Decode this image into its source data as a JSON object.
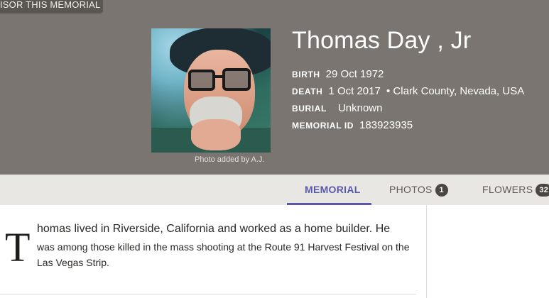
{
  "sponsor": {
    "label": "ISOR THIS MEMORIAL"
  },
  "photo": {
    "credit": "Photo added by A.J."
  },
  "person": {
    "name": "Thomas Day , Jr",
    "birth_label": "BIRTH",
    "birth_value": "29 Oct 1972",
    "death_label": "DEATH",
    "death_value": "1 Oct 2017",
    "death_place": "• Clark County, Nevada, USA",
    "burial_label": "BURIAL",
    "burial_value": "Unknown",
    "memorial_id_label": "MEMORIAL ID",
    "memorial_id_value": "183923935"
  },
  "tabs": [
    {
      "label": "MEMORIAL",
      "active": true
    },
    {
      "label": "PHOTOS",
      "count": "1"
    },
    {
      "label": "FLOWERS",
      "count": "32"
    }
  ],
  "bio": {
    "dropcap": "T",
    "first_line": "homas lived in Riverside, California and worked as a home builder. He",
    "rest": "was among those killed in the mass shooting at the Route 91 Harvest Festival on the Las Vegas Strip."
  },
  "colors": {
    "header_bg": "#7a7570",
    "tab_active": "#5b5aa8",
    "tabbar_bg": "#e9e7e4"
  }
}
